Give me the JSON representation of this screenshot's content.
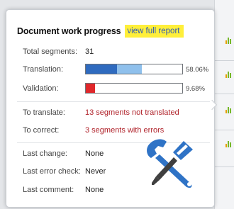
{
  "colors": {
    "translation_dark": "#2f6bbf",
    "translation_light": "#8fc0ec",
    "validation": "#e0282b",
    "error_text": "#b0222a",
    "link": "#2f5bb4",
    "highlight": "#ffef3a",
    "tool_icon": "#2f73c6"
  },
  "popup": {
    "title": "Document work progress",
    "link": "view full report"
  },
  "stats": {
    "total_label": "Total segments:",
    "total_value": "31",
    "translation_label": "Translation:",
    "translation_pct": "58.06%",
    "translation_done_fraction": 0.58,
    "translation_dark_fraction": 0.32,
    "validation_label": "Validation:",
    "validation_pct": "9.68%",
    "validation_fraction": 0.0968
  },
  "todo": {
    "translate_label": "To translate:",
    "translate_value": "13 segments not translated",
    "correct_label": "To correct:",
    "correct_value": "3 segments with errors"
  },
  "history": {
    "last_change_label": "Last change:",
    "last_change_value": "None",
    "last_error_label": "Last error check:",
    "last_error_value": "Never",
    "last_comment_label": "Last comment:",
    "last_comment_value": "None"
  },
  "icons": {
    "tool": "wrench-screwdriver-icon",
    "side": "bar-chart-icon"
  }
}
